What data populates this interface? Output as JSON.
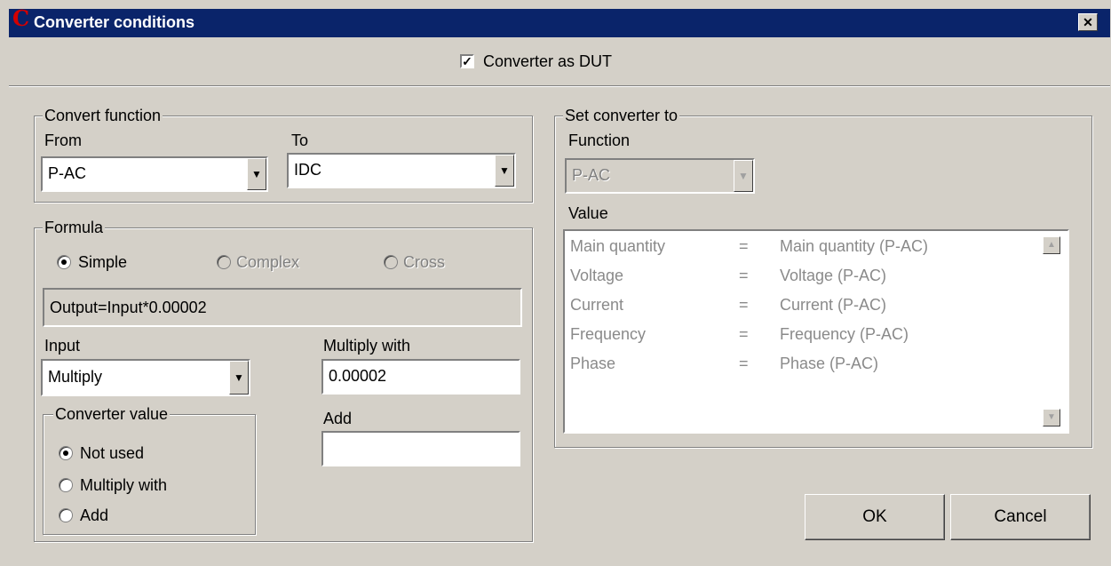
{
  "window": {
    "title": "Converter conditions",
    "close_glyph": "✕"
  },
  "dut": {
    "label": "Converter as DUT",
    "checked": true
  },
  "convert_function": {
    "legend": "Convert function",
    "from_label": "From",
    "from_value": "P-AC",
    "to_label": "To",
    "to_value": "IDC"
  },
  "formula": {
    "legend": "Formula",
    "options": {
      "simple": "Simple",
      "complex": "Complex",
      "cross": "Cross"
    },
    "selected": "simple",
    "expression": "Output=Input*0.00002",
    "input_label": "Input",
    "input_value": "Multiply",
    "multiply_label": "Multiply with",
    "multiply_value": "0.00002",
    "add_label": "Add",
    "add_value": ""
  },
  "converter_value": {
    "legend": "Converter value",
    "options": [
      "Not used",
      "Multiply with",
      "Add"
    ],
    "selected": 0
  },
  "set_converter": {
    "legend": "Set converter to",
    "function_label": "Function",
    "function_value": "P-AC",
    "value_label": "Value",
    "rows": [
      {
        "name": "Main quantity",
        "eq": "=",
        "value": "Main quantity (P-AC)"
      },
      {
        "name": "Voltage",
        "eq": "=",
        "value": "Voltage (P-AC)"
      },
      {
        "name": "Current",
        "eq": "=",
        "value": "Current (P-AC)"
      },
      {
        "name": "Frequency",
        "eq": "=",
        "value": "Frequency (P-AC)"
      },
      {
        "name": "Phase",
        "eq": "=",
        "value": "Phase (P-AC)"
      }
    ]
  },
  "buttons": {
    "ok": "OK",
    "cancel": "Cancel"
  }
}
